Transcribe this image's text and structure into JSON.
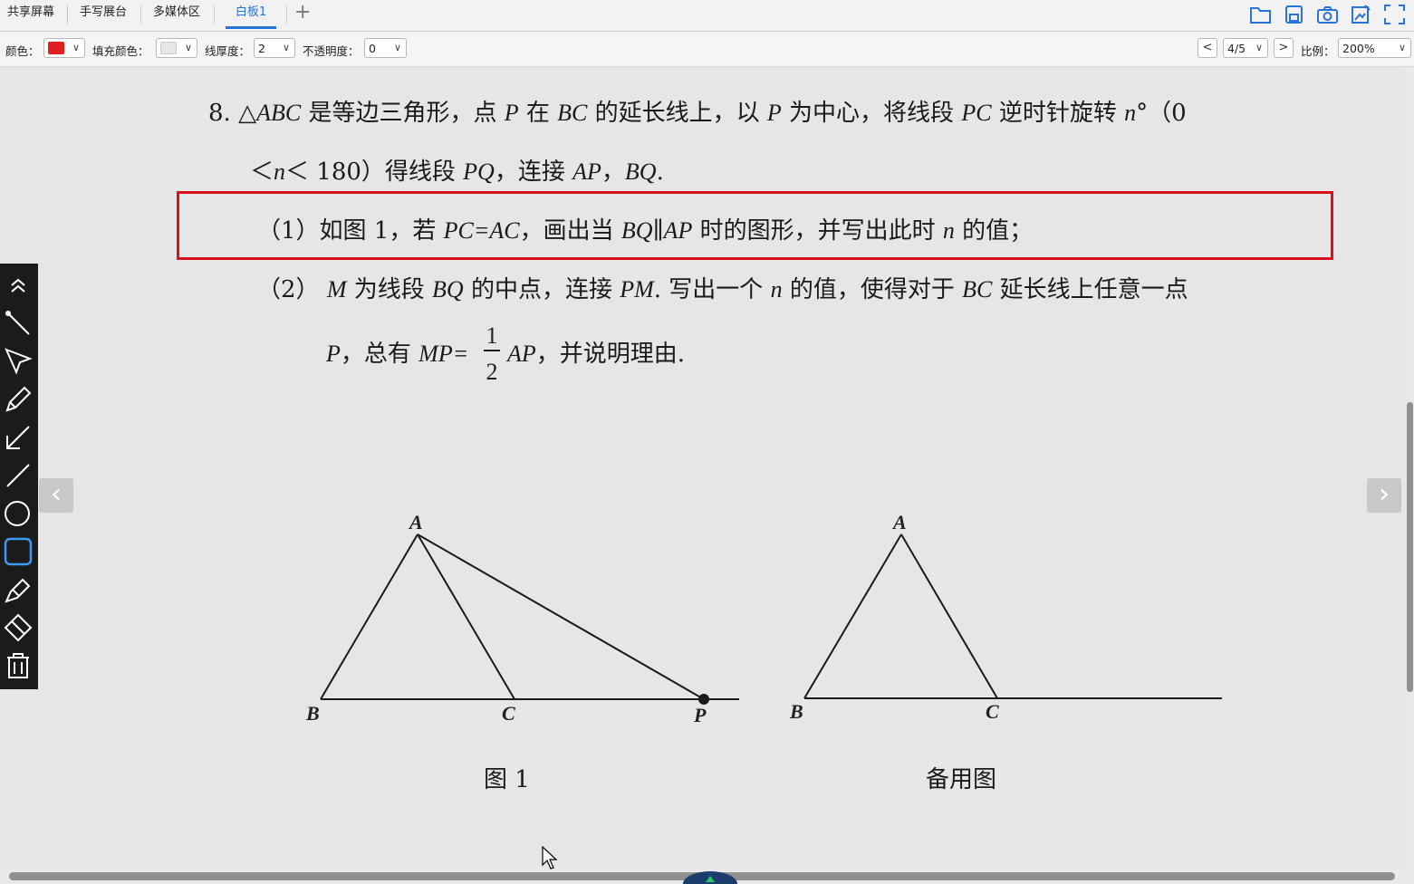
{
  "tabs": [
    {
      "label": "共享屏幕",
      "active": false
    },
    {
      "label": "手写展台",
      "active": false
    },
    {
      "label": "多媒体区",
      "active": false
    },
    {
      "label": "白板1",
      "active": true
    }
  ],
  "add_tab_label": "+",
  "top_icons": [
    "folder-icon",
    "save-icon",
    "camera-icon",
    "edit-image-icon",
    "fullscreen-icon"
  ],
  "props": {
    "color_label": "颜色：",
    "color_value": "#e02020",
    "fill_label": "填充颜色：",
    "fill_value": "#e6e6e6",
    "thickness_label": "线厚度：",
    "thickness_value": "2",
    "opacity_label": "不透明度：",
    "opacity_value": "0",
    "page_prev": "<",
    "page_value": "4/5",
    "page_next": ">",
    "scale_label": "比例：",
    "scale_value": "200%"
  },
  "question": {
    "num": "8.",
    "l1_a": "△",
    "l1_b": "ABC",
    "l1_c": " 是等边三角形，点 ",
    "l1_d": "P",
    "l1_e": " 在 ",
    "l1_f": "BC",
    "l1_g": " 的延长线上，以 ",
    "l1_h": "P",
    "l1_i": " 为中心，将线段 ",
    "l1_j": "PC",
    "l1_k": " 逆时针旋转 ",
    "l1_l": "n",
    "l1_m": "°（0",
    "l2_a": "＜",
    "l2_b": "n",
    "l2_c": "＜ 180）得线段 ",
    "l2_d": "PQ",
    "l2_e": "，连接 ",
    "l2_f": "AP",
    "l2_g": "，",
    "l2_h": "BQ",
    "l2_i": ".",
    "p1_a": "（1）如图 1，若 ",
    "p1_b": "PC=AC",
    "p1_c": "，画出当 ",
    "p1_d": "BQ∥AP",
    "p1_e": " 时的图形，并写出此时 ",
    "p1_f": "n",
    "p1_g": " 的值；",
    "p2_a": "（2） ",
    "p2_b": "M",
    "p2_c": " 为线段 ",
    "p2_d": "BQ",
    "p2_e": " 的中点，连接 ",
    "p2_f": "PM",
    "p2_g": ". 写出一个 ",
    "p2_h": "n",
    "p2_i": " 的值，使得对于 ",
    "p2_j": "BC",
    "p2_k": " 延长线上任意一点",
    "p2b_a": "P",
    "p2b_b": "，总有 ",
    "p2b_c": "MP=",
    "p2b_num": "1",
    "p2b_den": "2",
    "p2b_d": "AP",
    "p2b_e": "，并说明理由."
  },
  "figure1": {
    "A": "A",
    "B": "B",
    "C": "C",
    "P": "P",
    "caption": "图 1"
  },
  "figure2": {
    "A": "A",
    "B": "B",
    "C": "C",
    "caption": "备用图"
  },
  "nav": {
    "prev": "‹",
    "next": "›"
  },
  "tools": [
    "collapse-icon",
    "pointer-line-icon",
    "select-arrow-icon",
    "pen-icon",
    "arrow-line-icon",
    "line-icon",
    "circle-icon",
    "rectangle-icon",
    "highlighter-icon",
    "eraser-icon",
    "trash-icon"
  ]
}
